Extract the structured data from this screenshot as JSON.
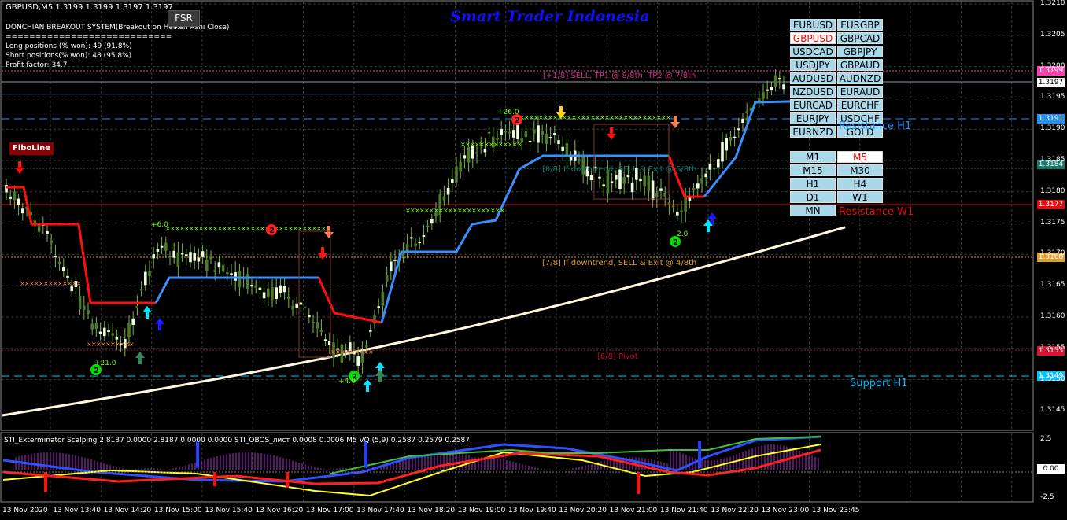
{
  "chart_header": "GBPUSD,M5  1.3199 1.3199 1.3197 1.3197",
  "fsr_button": "FSR",
  "brand": "Smart Trader Indonesia",
  "system_info": [
    "DONCHIAN BREAKOUT SYSTEM(Breakout on Heiken Ashi Close)",
    "============================",
    "Long positions (% won): 49 (91.8%)",
    "Short positions(% won): 48 (95.8%)",
    "Profit factor: 34.7"
  ],
  "fibo_label": "FiboLine",
  "pairs": [
    [
      "EURUSD",
      "EURGBP"
    ],
    [
      "GBPUSD",
      "GBPCAD"
    ],
    [
      "USDCAD",
      "GBPJPY"
    ],
    [
      "USDJPY",
      "GBPAUD"
    ],
    [
      "AUDUSD",
      "AUDNZD"
    ],
    [
      "NZDUSD",
      "EURAUD"
    ],
    [
      "EURCAD",
      "EURCHF"
    ],
    [
      "EURJPY",
      "USDCHF"
    ],
    [
      "EURNZD",
      "GOLD"
    ]
  ],
  "active_pair": "GBPUSD",
  "timeframes": [
    [
      "M1",
      "M5"
    ],
    [
      "M15",
      "M30"
    ],
    [
      "H1",
      "H4"
    ],
    [
      "D1",
      "W1"
    ],
    [
      "MN",
      ""
    ]
  ],
  "active_tf": "M5",
  "level_labels": {
    "tp_sell": "[+1/8] SELL, TP1 @ 8/8th, TP2 @ 7/8th",
    "res_h1": "Resistance H1",
    "res_w1": "Resistance W1",
    "downtrend88": "[8/8] If downtrend, SELL & Exit @ 6/8th",
    "downtrend78": "[7/8] If downtrend, SELL & Exit @ 4/8th",
    "pivot": "[6/8] Pivot",
    "support_h1": "Support H1"
  },
  "signal_labels": {
    "s1": "+6.0",
    "s2": "+26.0",
    "s3": "+21.0",
    "s4": "+4.0",
    "s5": "2.0"
  },
  "price_tags": {
    "p1": {
      "text": "1.3199",
      "color": "#ff3fb0"
    },
    "p2": {
      "text": "1.3197",
      "color": "#ffffff"
    },
    "p3": {
      "text": "1.3191",
      "color": "#1e90ff"
    },
    "p4": {
      "text": "1.3184",
      "color": "#1a7a6a"
    },
    "p5": {
      "text": "1.3177",
      "color": "#e01010"
    },
    "p6": {
      "text": "1.3168",
      "color": "#e0a030"
    },
    "p7": {
      "text": "1.3153",
      "color": "#e01030"
    },
    "p8": {
      "text": "1.3149",
      "color": "#00bfff"
    }
  },
  "y_axis": [
    "1.3210",
    "1.3205",
    "1.3200",
    "1.3195",
    "1.3190",
    "1.3185",
    "1.3180",
    "1.3175",
    "1.3170",
    "1.3165",
    "1.3160",
    "1.3155",
    "1.3150",
    "1.3145"
  ],
  "x_axis": [
    "13 Nov 2020",
    "13 Nov 13:40",
    "13 Nov 14:20",
    "13 Nov 15:00",
    "13 Nov 15:40",
    "13 Nov 16:20",
    "13 Nov 17:00",
    "13 Nov 17:40",
    "13 Nov 18:20",
    "13 Nov 19:00",
    "13 Nov 19:40",
    "13 Nov 20:20",
    "13 Nov 21:00",
    "13 Nov 21:40",
    "13 Nov 22:20",
    "13 Nov 23:00",
    "13 Nov 23:45"
  ],
  "sub_label": "STI_Exterminator Scalping 2.8187 0.0000 2.8187 0.0000 0.0000  STI_OBOS_лист 0.0008 0.0006  M5 VQ (5,9) 0.2587 0.2579 0.2587",
  "sub_axis": [
    "2.5",
    "0.00",
    "-2.5"
  ]
}
